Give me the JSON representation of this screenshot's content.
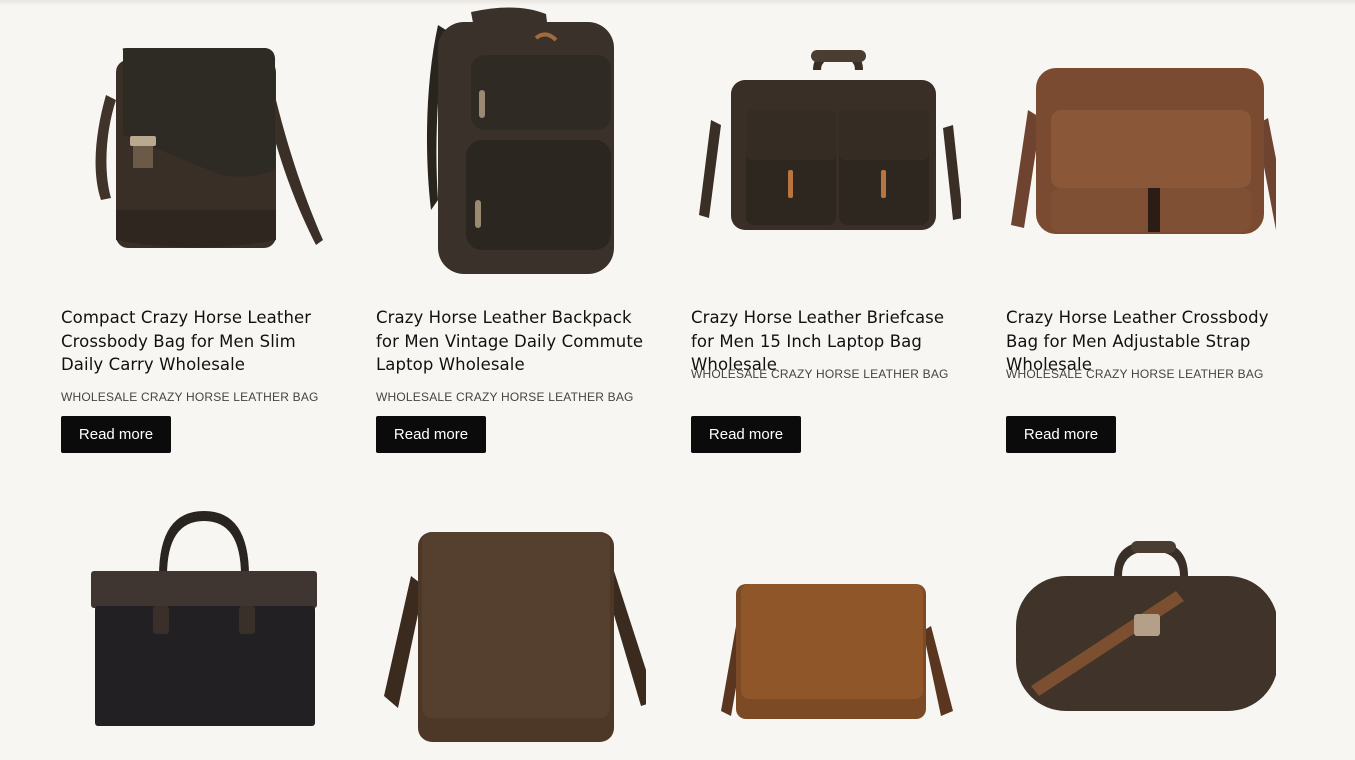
{
  "products": [
    {
      "title": "Compact Crazy Horse Leather Crossbody Bag for Men Slim Daily Carry Wholesale",
      "category": "WHOLESALE CRAZY HORSE LEATHER BAG",
      "button_label": "Read more",
      "image_icon": "crossbody-bag-image"
    },
    {
      "title": "Crazy Horse Leather Backpack for Men Vintage Daily Commute Laptop Wholesale",
      "category": "WHOLESALE CRAZY HORSE LEATHER BAG",
      "button_label": "Read more",
      "image_icon": "backpack-image"
    },
    {
      "title": "Crazy Horse Leather Briefcase for Men 15 Inch Laptop Bag Wholesale",
      "category": "WHOLESALE CRAZY HORSE LEATHER BAG",
      "button_label": "Read more",
      "image_icon": "briefcase-image"
    },
    {
      "title": "Crazy Horse Leather Crossbody Bag for Men Adjustable Strap Wholesale",
      "category": "WHOLESALE CRAZY HORSE LEATHER BAG",
      "button_label": "Read more",
      "image_icon": "brown-crossbody-bag-image"
    },
    {
      "image_icon": "tote-bag-image"
    },
    {
      "image_icon": "messenger-bag-image"
    },
    {
      "image_icon": "tan-messenger-bag-image"
    },
    {
      "image_icon": "duffel-bag-image"
    }
  ],
  "colors": {
    "background": "#f8f6f2",
    "button": "#0b0b0b",
    "button_text": "#ffffff",
    "title_text": "#111111",
    "category_text": "#444444"
  }
}
